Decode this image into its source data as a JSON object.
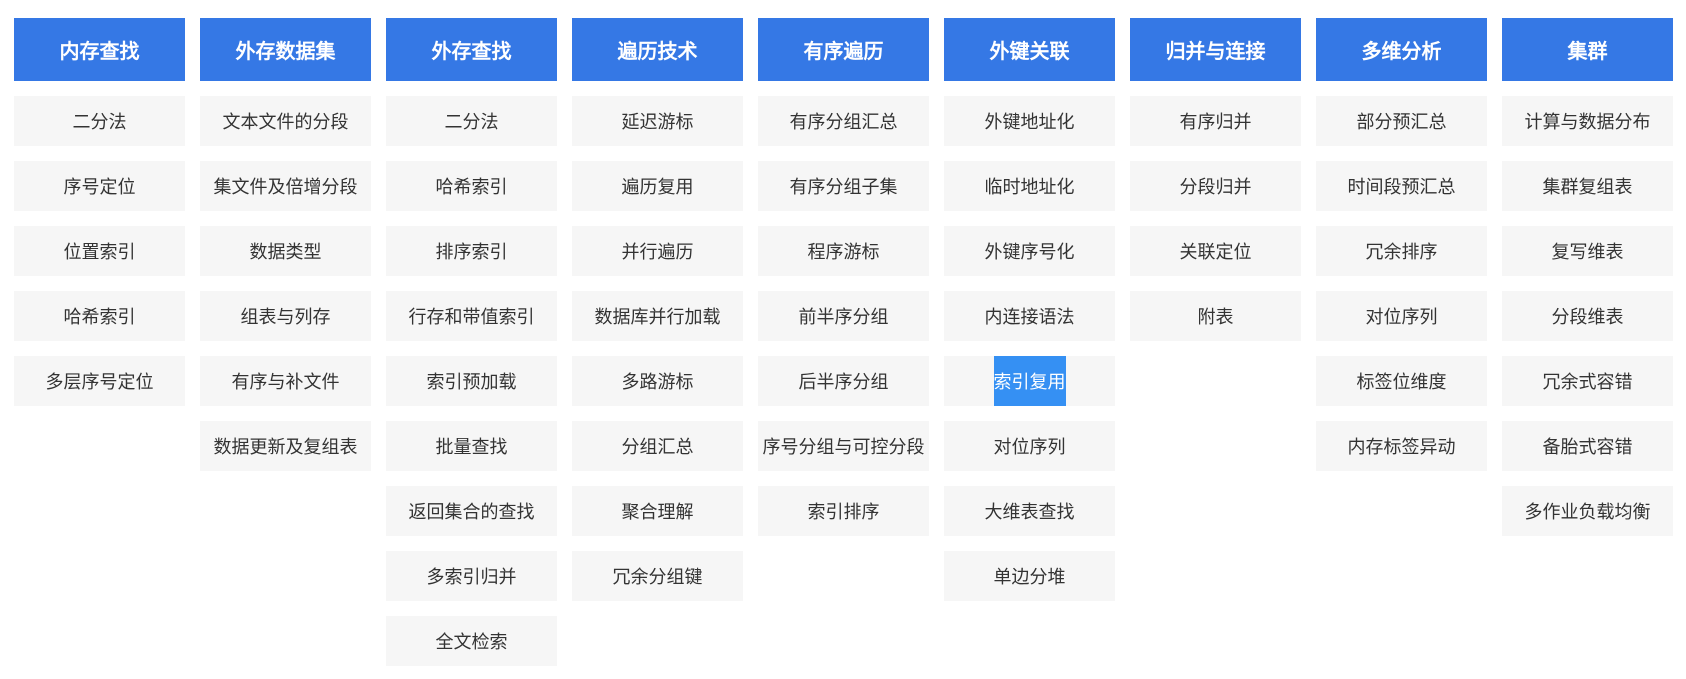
{
  "colors": {
    "header_bg": "#3578e5",
    "header_text": "#ffffff",
    "item_bg": "#f6f6f6",
    "item_text": "#333333",
    "highlight_bg": "#3590f3"
  },
  "menu": {
    "columns": [
      {
        "title": "内存查找",
        "items": [
          "二分法",
          "序号定位",
          "位置索引",
          "哈希索引",
          "多层序号定位"
        ]
      },
      {
        "title": "外存数据集",
        "items": [
          "文本文件的分段",
          "集文件及倍增分段",
          "数据类型",
          "组表与列存",
          "有序与补文件",
          "数据更新及复组表"
        ]
      },
      {
        "title": "外存查找",
        "items": [
          "二分法",
          "哈希索引",
          "排序索引",
          "行存和带值索引",
          "索引预加载",
          "批量查找",
          "返回集合的查找",
          "多索引归并",
          "全文检索"
        ]
      },
      {
        "title": "遍历技术",
        "items": [
          "延迟游标",
          "遍历复用",
          "并行遍历",
          "数据库并行加载",
          "多路游标",
          "分组汇总",
          "聚合理解",
          "冗余分组键"
        ]
      },
      {
        "title": "有序遍历",
        "items": [
          "有序分组汇总",
          "有序分组子集",
          "程序游标",
          "前半序分组",
          "后半序分组",
          "序号分组与可控分段",
          "索引排序"
        ]
      },
      {
        "title": "外键关联",
        "items": [
          "外键地址化",
          "临时地址化",
          "外键序号化",
          "内连接语法",
          "索引复用",
          "对位序列",
          "大维表查找",
          "单边分堆"
        ],
        "active_index": 4
      },
      {
        "title": "归并与连接",
        "items": [
          "有序归并",
          "分段归并",
          "关联定位",
          "附表"
        ]
      },
      {
        "title": "多维分析",
        "items": [
          "部分预汇总",
          "时间段预汇总",
          "冗余排序",
          "对位序列",
          "标签位维度",
          "内存标签异动"
        ]
      },
      {
        "title": "集群",
        "items": [
          "计算与数据分布",
          "集群复组表",
          "复写维表",
          "分段维表",
          "冗余式容错",
          "备胎式容错",
          "多作业负载均衡"
        ]
      }
    ]
  }
}
